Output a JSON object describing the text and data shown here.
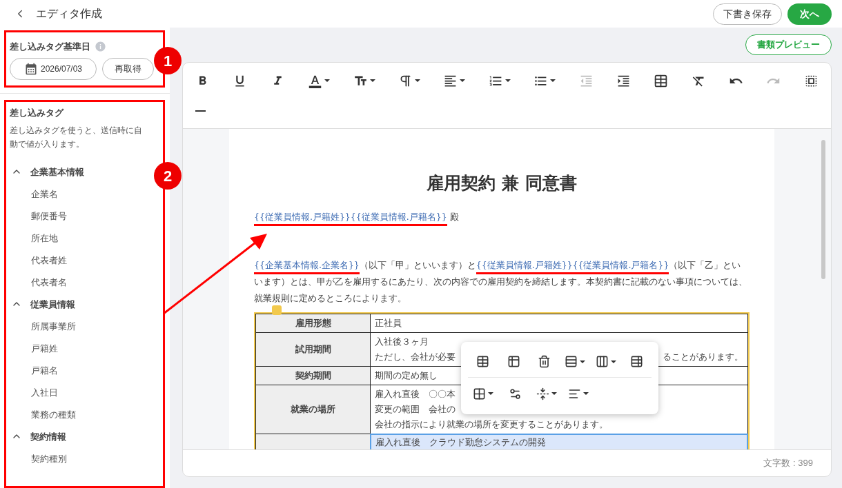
{
  "header": {
    "title": "エディタ作成",
    "buttons": [
      {
        "label": "下書き保存",
        "kind": "outline"
      },
      {
        "label": "次へ",
        "kind": "primary"
      }
    ]
  },
  "sidebar": {
    "base_date": {
      "title": "差し込みタグ基準日",
      "date": "2026/07/03",
      "refresh_button": "再取得"
    },
    "tags": {
      "title": "差し込みタグ",
      "description": "差し込みタグを使うと、送信時に自動で値が入ります。",
      "groups": [
        {
          "label": "企業基本情報",
          "expanded": true,
          "children": [
            {
              "label": "企業名"
            },
            {
              "label": "郵便番号"
            },
            {
              "label": "所在地"
            },
            {
              "label": "代表者姓"
            },
            {
              "label": "代表者名"
            }
          ]
        },
        {
          "label": "従業員情報",
          "expanded": true,
          "children": [
            {
              "label": "所属事業所"
            },
            {
              "label": "戸籍姓"
            },
            {
              "label": "戸籍名"
            },
            {
              "label": "入社日"
            },
            {
              "label": "業務の種類"
            }
          ]
        },
        {
          "label": "契約情報",
          "expanded": true,
          "children": [
            {
              "label": "契約種別"
            }
          ]
        }
      ]
    }
  },
  "annotations": {
    "badges": [
      "1",
      "2"
    ]
  },
  "preview_button": "書類プレビュー",
  "editor": {
    "toolbar": [
      [
        {
          "kind": "bold",
          "disabled": false,
          "dropdown": false
        },
        {
          "kind": "underline",
          "disabled": false,
          "dropdown": false
        },
        {
          "kind": "italic",
          "disabled": false,
          "dropdown": false
        },
        {
          "kind": "font_color",
          "disabled": false,
          "dropdown": true
        },
        {
          "kind": "font_size",
          "disabled": false,
          "dropdown": true
        },
        {
          "kind": "paragraph",
          "disabled": false,
          "dropdown": true
        },
        {
          "kind": "align",
          "disabled": false,
          "dropdown": true
        },
        {
          "kind": "ordered_list",
          "disabled": false,
          "dropdown": true
        },
        {
          "kind": "bullet_list",
          "disabled": false,
          "dropdown": true
        },
        {
          "kind": "outdent",
          "disabled": true,
          "dropdown": false
        },
        {
          "kind": "indent",
          "disabled": false,
          "dropdown": false
        },
        {
          "kind": "table",
          "disabled": false,
          "dropdown": false
        },
        {
          "kind": "clear_format",
          "disabled": false,
          "dropdown": false
        },
        {
          "kind": "undo",
          "disabled": false,
          "dropdown": false
        },
        {
          "kind": "redo",
          "disabled": true,
          "dropdown": false
        },
        {
          "kind": "select_all",
          "disabled": false,
          "dropdown": false
        }
      ],
      [
        {
          "kind": "horizontal_rule",
          "disabled": false,
          "dropdown": false
        }
      ]
    ],
    "document": {
      "title": "雇用契約 兼 同意書",
      "paragraphs": [
        {
          "kind": "addressee",
          "segments": [
            {
              "kind": "tag",
              "text": "{{従業員情報.戸籍姓}}",
              "underlined": true
            },
            {
              "kind": "tag",
              "text": "{{従業員情報.戸籍名}}",
              "underlined": true
            },
            {
              "kind": "text",
              "text": " 殿"
            }
          ]
        },
        {
          "kind": "body",
          "segments": [
            {
              "kind": "tag",
              "text": "{{企業基本情報.企業名}}",
              "underlined": true
            },
            {
              "kind": "text",
              "text": "（以下「甲」といいます）と"
            },
            {
              "kind": "tag",
              "text": "{{従業員情報.戸籍姓}}",
              "underlined": true
            },
            {
              "kind": "tag",
              "text": "{{従業員情報.戸籍名}}",
              "underlined": true
            },
            {
              "kind": "text",
              "text": "（以下「乙」といいます）とは、甲が乙を雇用するにあたり、次の内容での雇用契約を締結します。本契約書に記載のない事項については、就業規則に定めるところによります。"
            }
          ]
        }
      ],
      "table": [
        {
          "label": "雇用形態",
          "selected": false,
          "lines": [
            [
              "正社員"
            ]
          ]
        },
        {
          "label": "試用期間",
          "selected": false,
          "lines": [
            [
              "入社後３ヶ月"
            ],
            [
              "ただし、会社が必要",
              "ることがあります。"
            ]
          ]
        },
        {
          "label": "契約期間",
          "selected": false,
          "lines": [
            [
              "期間の定め無し"
            ]
          ]
        },
        {
          "label": "就業の場所",
          "selected": false,
          "lines": [
            [
              "雇入れ直後　〇〇本"
            ],
            [
              "変更の範囲　会社の"
            ],
            [
              "会社の指示により就業の場所を変更することがあります。"
            ]
          ]
        },
        {
          "selected": true,
          "lines": [
            [
              "雇入れ直後　クラウド勤怠システムの開発"
            ]
          ]
        }
      ]
    },
    "table_popup": [
      [
        {
          "kind": "insert_table",
          "dropdown": false
        },
        {
          "kind": "table_rows",
          "dropdown": false
        },
        {
          "kind": "delete",
          "dropdown": false
        },
        {
          "kind": "row_menu",
          "dropdown": true
        },
        {
          "kind": "column_menu",
          "dropdown": true
        },
        {
          "kind": "table_settings",
          "dropdown": false
        }
      ],
      [
        {
          "kind": "cell_menu",
          "dropdown": true
        },
        {
          "kind": "cell_settings",
          "dropdown": false
        },
        {
          "kind": "vertical_align",
          "dropdown": true
        },
        {
          "kind": "horizontal_align",
          "dropdown": true
        }
      ]
    ],
    "char_count": "文字数 : 399"
  }
}
